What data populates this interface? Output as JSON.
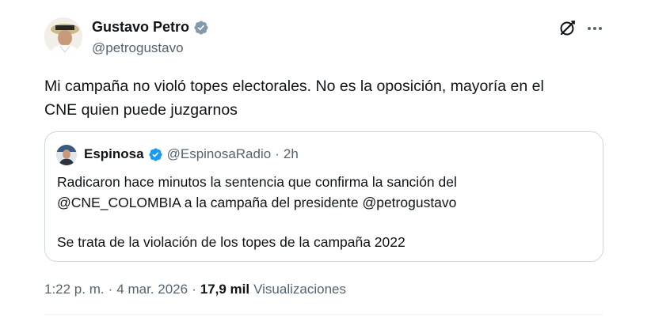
{
  "author": {
    "name": "Gustavo Petro",
    "handle": "@petrogustavo",
    "verified_color": "#829aab"
  },
  "tweet": {
    "line1": "Mi campaña no violó topes electorales. No es la oposición, mayoría en el",
    "line2": "CNE quien puede juzgarnos"
  },
  "quote": {
    "name": "Espinosa",
    "handle": "@EspinosaRadio",
    "separator": "·",
    "time": "2h",
    "verified_color": "#1d9bf0",
    "line1": "Radicaron hace minutos la sentencia que confirma la sanción del",
    "line2": "@CNE_COLOMBIA a la campaña del presidente @petrogustavo",
    "line3": "Se trata de la violación de los topes de la campaña 2022"
  },
  "meta": {
    "time": "1:22 p. m.",
    "sep1": "·",
    "date": "4 mar. 2026",
    "sep2": "·",
    "views_count": "17,9 mil",
    "views_label": "Visualizaciones"
  },
  "icons": {
    "grok": "grok-icon",
    "more": "more-icon",
    "verified": "verified-badge-icon"
  },
  "colors": {
    "text": "#0f1419",
    "secondary": "#536471",
    "border": "#cfd9de"
  }
}
